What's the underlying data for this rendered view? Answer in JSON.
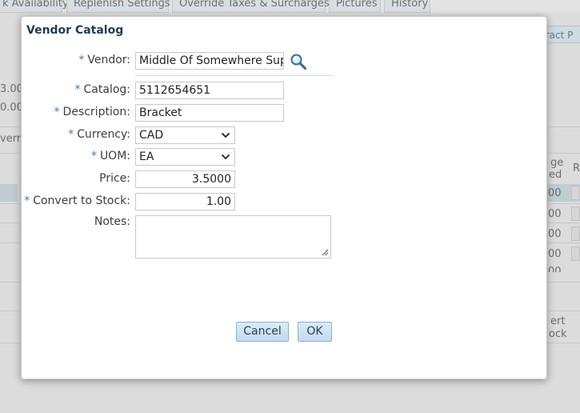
{
  "background": {
    "tabs": [
      "k Availability",
      "Replenish Settings",
      "Override Taxes & Surcharges",
      "Pictures",
      "History"
    ],
    "right_button_label": "tract P",
    "left_values": [
      "3.00",
      "0.00"
    ],
    "left_tab_fragment": "verri",
    "right_header": [
      "ge",
      "ed"
    ],
    "right_col_header": "R",
    "right_values": [
      "00",
      "00",
      "00",
      "00",
      "00"
    ],
    "right_footer": [
      "ert",
      "ock"
    ]
  },
  "dialog": {
    "title": "Vendor Catalog",
    "required_marker": "*",
    "fields": {
      "vendor": {
        "label": "Vendor:",
        "value": "Middle Of Somewhere Supplie"
      },
      "catalog": {
        "label": "Catalog:",
        "value": "5112654651"
      },
      "description": {
        "label": "Description:",
        "value": "Bracket"
      },
      "currency": {
        "label": "Currency:",
        "value": "CAD"
      },
      "uom": {
        "label": "UOM:",
        "value": "EA"
      },
      "price": {
        "label": "Price:",
        "value": "3.5000"
      },
      "convert_to_stock": {
        "label": "Convert to Stock:",
        "value": "1.00"
      },
      "notes": {
        "label": "Notes:",
        "value": ""
      }
    },
    "buttons": {
      "cancel": "Cancel",
      "ok": "OK"
    }
  },
  "icons": {
    "search": "search-icon",
    "dropdown": "chevron-down-icon",
    "resize": "resize-grip-icon"
  },
  "colors": {
    "title": "#1f3b57",
    "required": "#3f7fae",
    "button_border": "#8fb0cc"
  }
}
